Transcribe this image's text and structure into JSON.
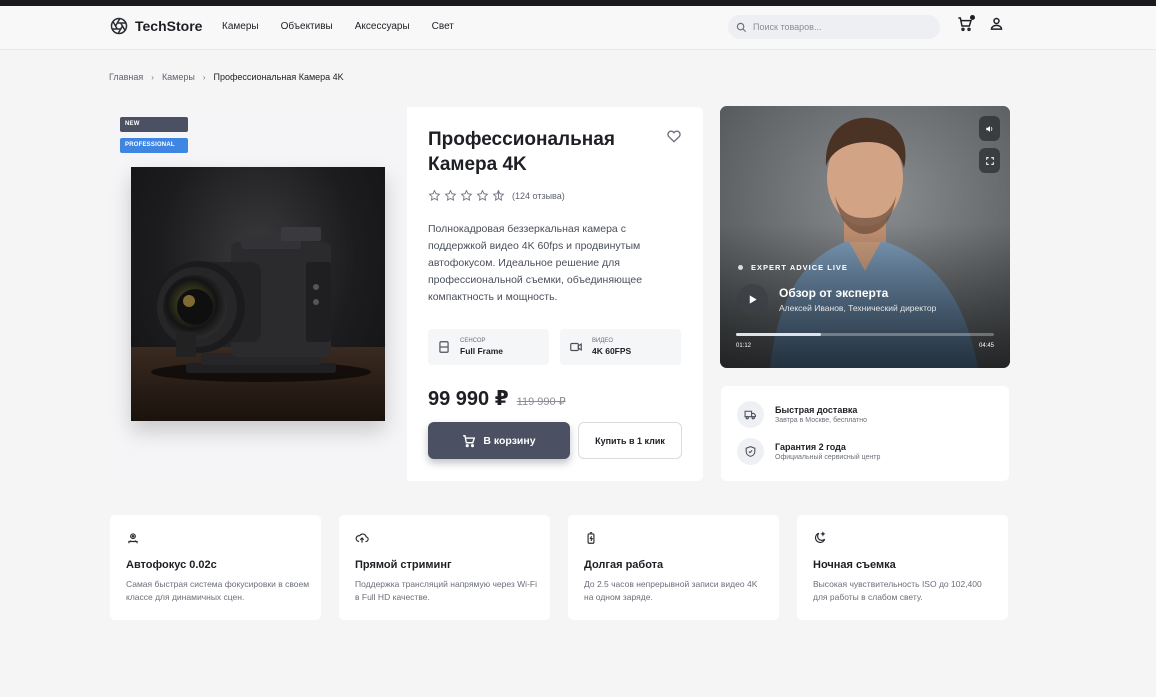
{
  "header": {
    "brand": "TechStore",
    "nav": [
      "Камеры",
      "Объективы",
      "Аксессуары",
      "Свет"
    ],
    "search_placeholder": "Поиск товаров..."
  },
  "breadcrumb": {
    "items": [
      "Главная",
      "Камеры"
    ],
    "current": "Профессиональная Камера 4K"
  },
  "product": {
    "badges": {
      "new": "NEW",
      "pro": "PROFESSIONAL"
    },
    "title": "Профессиональная Камера 4K",
    "rating_stars": 5,
    "reviews": "(124 отзыва)",
    "description": "Полнокадровая беззеркальная камера с поддержкой видео 4K 60fps и продвинутым автофокусом. Идеальное решение для профессиональной съемки, объединяющее компактность и мощность.",
    "specs": [
      {
        "label": "Сенсор",
        "value": "Full Frame",
        "icon": "sensor-icon"
      },
      {
        "label": "Видео",
        "value": "4K 60FPS",
        "icon": "video-icon"
      }
    ],
    "price": "99 990 ₽",
    "old_price": "119 990 ₽",
    "cart_label": "В корзину",
    "oneclick_label": "Купить в 1 клик"
  },
  "video": {
    "live_label": "EXPERT ADVICE LIVE",
    "title": "Обзор от эксперта",
    "subtitle": "Алексей Иванов, Технический директор",
    "time_current": "01:12",
    "time_total": "04:45",
    "progress": 0.33
  },
  "perks": [
    {
      "title": "Быстрая доставка",
      "subtitle": "Завтра в Москве, бесплатно",
      "icon": "truck-icon"
    },
    {
      "title": "Гарантия 2 года",
      "subtitle": "Официальный сервисный центр",
      "icon": "shield-icon"
    }
  ],
  "features": [
    {
      "title": "Автофокус 0.02с",
      "desc": "Самая быстрая система фокусировки в своем классе для динамичных сцен.",
      "icon": "focus-icon"
    },
    {
      "title": "Прямой стриминг",
      "desc": "Поддержка трансляций напрямую через Wi-Fi в Full HD качестве.",
      "icon": "cloud-upload-icon"
    },
    {
      "title": "Долгая работа",
      "desc": "До 2.5 часов непрерывной записи видео 4K на одном заряде.",
      "icon": "battery-icon"
    },
    {
      "title": "Ночная съемка",
      "desc": "Высокая чувствительность ISO до 102,400 для работы в слабом свету.",
      "icon": "night-icon"
    }
  ],
  "colors": {
    "accent": "#4b5162",
    "badge_pro": "#3f86e2",
    "background": "#f6f5f6"
  }
}
